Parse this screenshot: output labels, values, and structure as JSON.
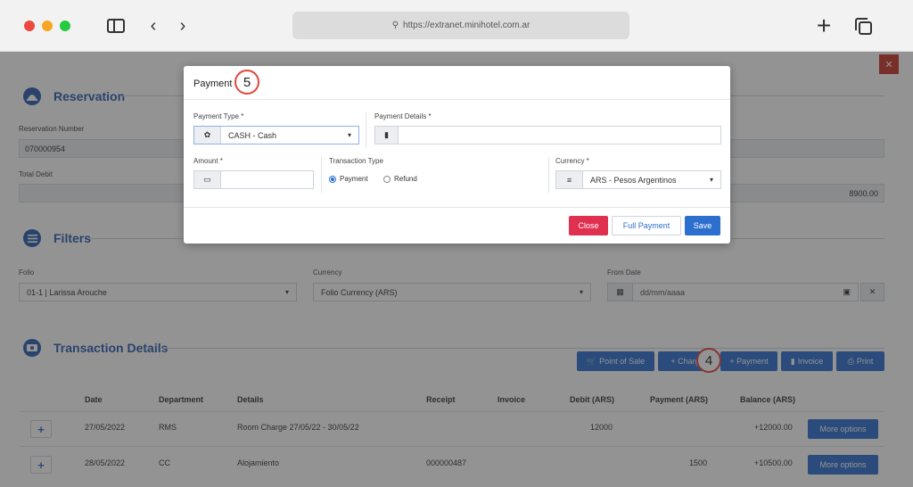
{
  "browser": {
    "url": "https://extranet.minihotel.com.ar"
  },
  "reservation": {
    "title": "Reservation",
    "number_label": "Reservation Number",
    "number_value": "070000954",
    "total_debit_label": "Total Debit",
    "total_value": "8900.00"
  },
  "filters": {
    "title": "Filters",
    "folio_label": "Folio",
    "folio_value": "01-1 | Larissa Arouche",
    "currency_label": "Currency",
    "currency_value": "Folio Currency (ARS)",
    "from_date_label": "From Date",
    "from_date_placeholder": "dd/mm/aaaa"
  },
  "transactions": {
    "title": "Transaction Details",
    "buttons": {
      "point_of_sale": "Point of Sale",
      "charge": "+ Charge",
      "payment": "+ Payment",
      "invoice": "Invoice",
      "print": "Print"
    },
    "columns": [
      "Date",
      "Department",
      "Details",
      "Receipt",
      "Invoice",
      "Debit (ARS)",
      "Payment (ARS)",
      "Balance (ARS)"
    ],
    "rows": [
      {
        "date": "27/05/2022",
        "department": "RMS",
        "details": "Room Charge 27/05/22 - 30/05/22",
        "receipt": "",
        "invoice": "",
        "debit": "12000",
        "payment": "",
        "balance": "+12000.00",
        "action": "More options"
      },
      {
        "date": "28/05/2022",
        "department": "CC",
        "details": "Alojamiento",
        "receipt": "000000487",
        "invoice": "",
        "debit": "",
        "payment": "1500",
        "balance": "+10500.00",
        "action": "More options"
      }
    ]
  },
  "modal": {
    "title": "Payment",
    "payment_type_label": "Payment Type *",
    "payment_type_value": "CASH - Cash",
    "payment_details_label": "Payment Details *",
    "amount_label": "Amount *",
    "transaction_type_label": "Transaction Type",
    "radio_payment": "Payment",
    "radio_refund": "Refund",
    "currency_label": "Currency *",
    "currency_value": "ARS - Pesos Argentinos",
    "close_label": "Close",
    "full_payment_label": "Full Payment",
    "save_label": "Save"
  },
  "annotations": {
    "step5": "5",
    "step4": "4"
  },
  "colors": {
    "primary": "#2d6fcf",
    "section": "#2b5fb3",
    "danger": "#e03050",
    "badge_ring": "#e0483b"
  },
  "icons": {
    "address": "magnifier-icon",
    "payment_type": "piggy-bank-icon",
    "payment_details": "clipboard-icon",
    "amount": "money-icon",
    "currency": "coins-icon",
    "calendar": "calendar-icon"
  }
}
